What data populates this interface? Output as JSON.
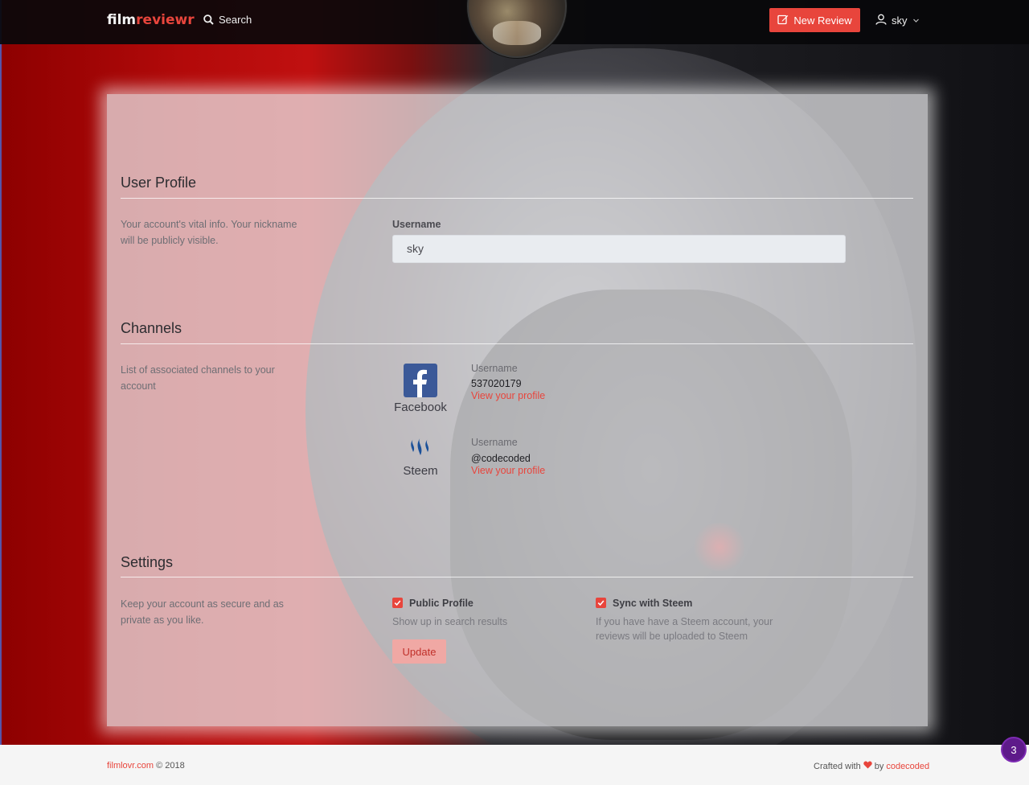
{
  "navbar": {
    "brand_part1": "film",
    "brand_part2": "reviewr",
    "search_label": "Search",
    "new_review_label": "New Review",
    "user_name": "sky"
  },
  "user_profile": {
    "title": "User Profile",
    "description": "Your account's vital info. Your nickname will be publicly visible.",
    "username_label": "Username",
    "username_value": "sky"
  },
  "channels": {
    "title": "Channels",
    "description": "List of associated channels to your account",
    "items": [
      {
        "name": "Facebook",
        "username_label": "Username",
        "username_value": "537020179",
        "link_label": "View your profile"
      },
      {
        "name": "Steem",
        "username_label": "Username",
        "username_value": "@codecoded",
        "link_label": "View your profile"
      }
    ]
  },
  "settings": {
    "title": "Settings",
    "description": "Keep your account as secure and as private as you like.",
    "public_profile_label": "Public Profile",
    "public_profile_help": "Show up in search results",
    "public_profile_checked": true,
    "sync_steem_label": "Sync with Steem",
    "sync_steem_help": "If you have have a Steem account, your reviews will be uploaded to Steem",
    "sync_steem_checked": true,
    "update_label": "Update"
  },
  "footer": {
    "site_link": "filmlovr.com",
    "copyright": "© 2018",
    "crafted_prefix": "Crafted with",
    "crafted_by": "by",
    "author_link": "codecoded"
  },
  "badge": {
    "count": "3"
  },
  "colors": {
    "accent": "#e8453c",
    "facebook": "#3b5998",
    "steem": "#1a5099",
    "badge": "#5e1a8a"
  }
}
